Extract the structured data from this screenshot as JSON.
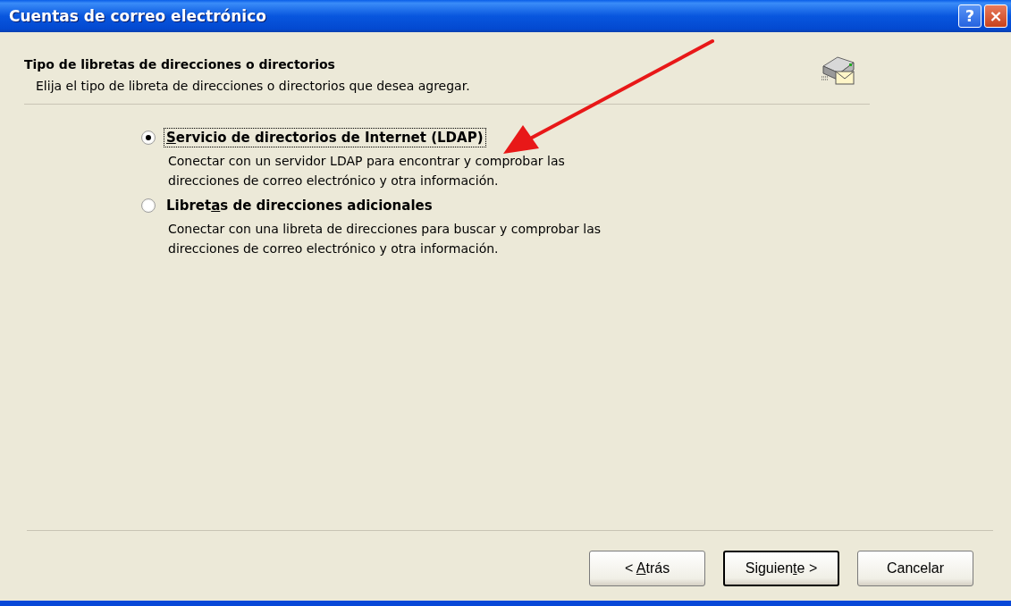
{
  "window": {
    "title": "Cuentas de correo electrónico",
    "controls": [
      {
        "kind": "help",
        "label": "?"
      },
      {
        "kind": "close",
        "label": "×"
      }
    ]
  },
  "header": {
    "title": "Tipo de libretas de direcciones o directorios",
    "subtitle": "Elija el tipo de libreta de direcciones o directorios que desea agregar."
  },
  "options": [
    {
      "label": {
        "key": "S",
        "after": "ervicio de directorios de Internet (LDAP)"
      },
      "selected": true,
      "focused": true,
      "description": "Conectar con un servidor LDAP para encontrar y comprobar las direcciones de correo electrónico y otra información."
    },
    {
      "label": {
        "before": "Libret",
        "key": "a",
        "after": "s de direcciones adicionales"
      },
      "selected": false,
      "focused": false,
      "description": "Conectar con una libreta de direcciones para buscar y comprobar las direcciones de correo electrónico y otra información."
    }
  ],
  "buttons": [
    {
      "label": {
        "before": "< ",
        "key": "A",
        "after": "trás"
      },
      "default": false
    },
    {
      "label": {
        "before": "Siguien",
        "key": "t",
        "after": "e >"
      },
      "default": true
    },
    {
      "label": {
        "before": "Cancelar"
      },
      "default": false
    }
  ]
}
